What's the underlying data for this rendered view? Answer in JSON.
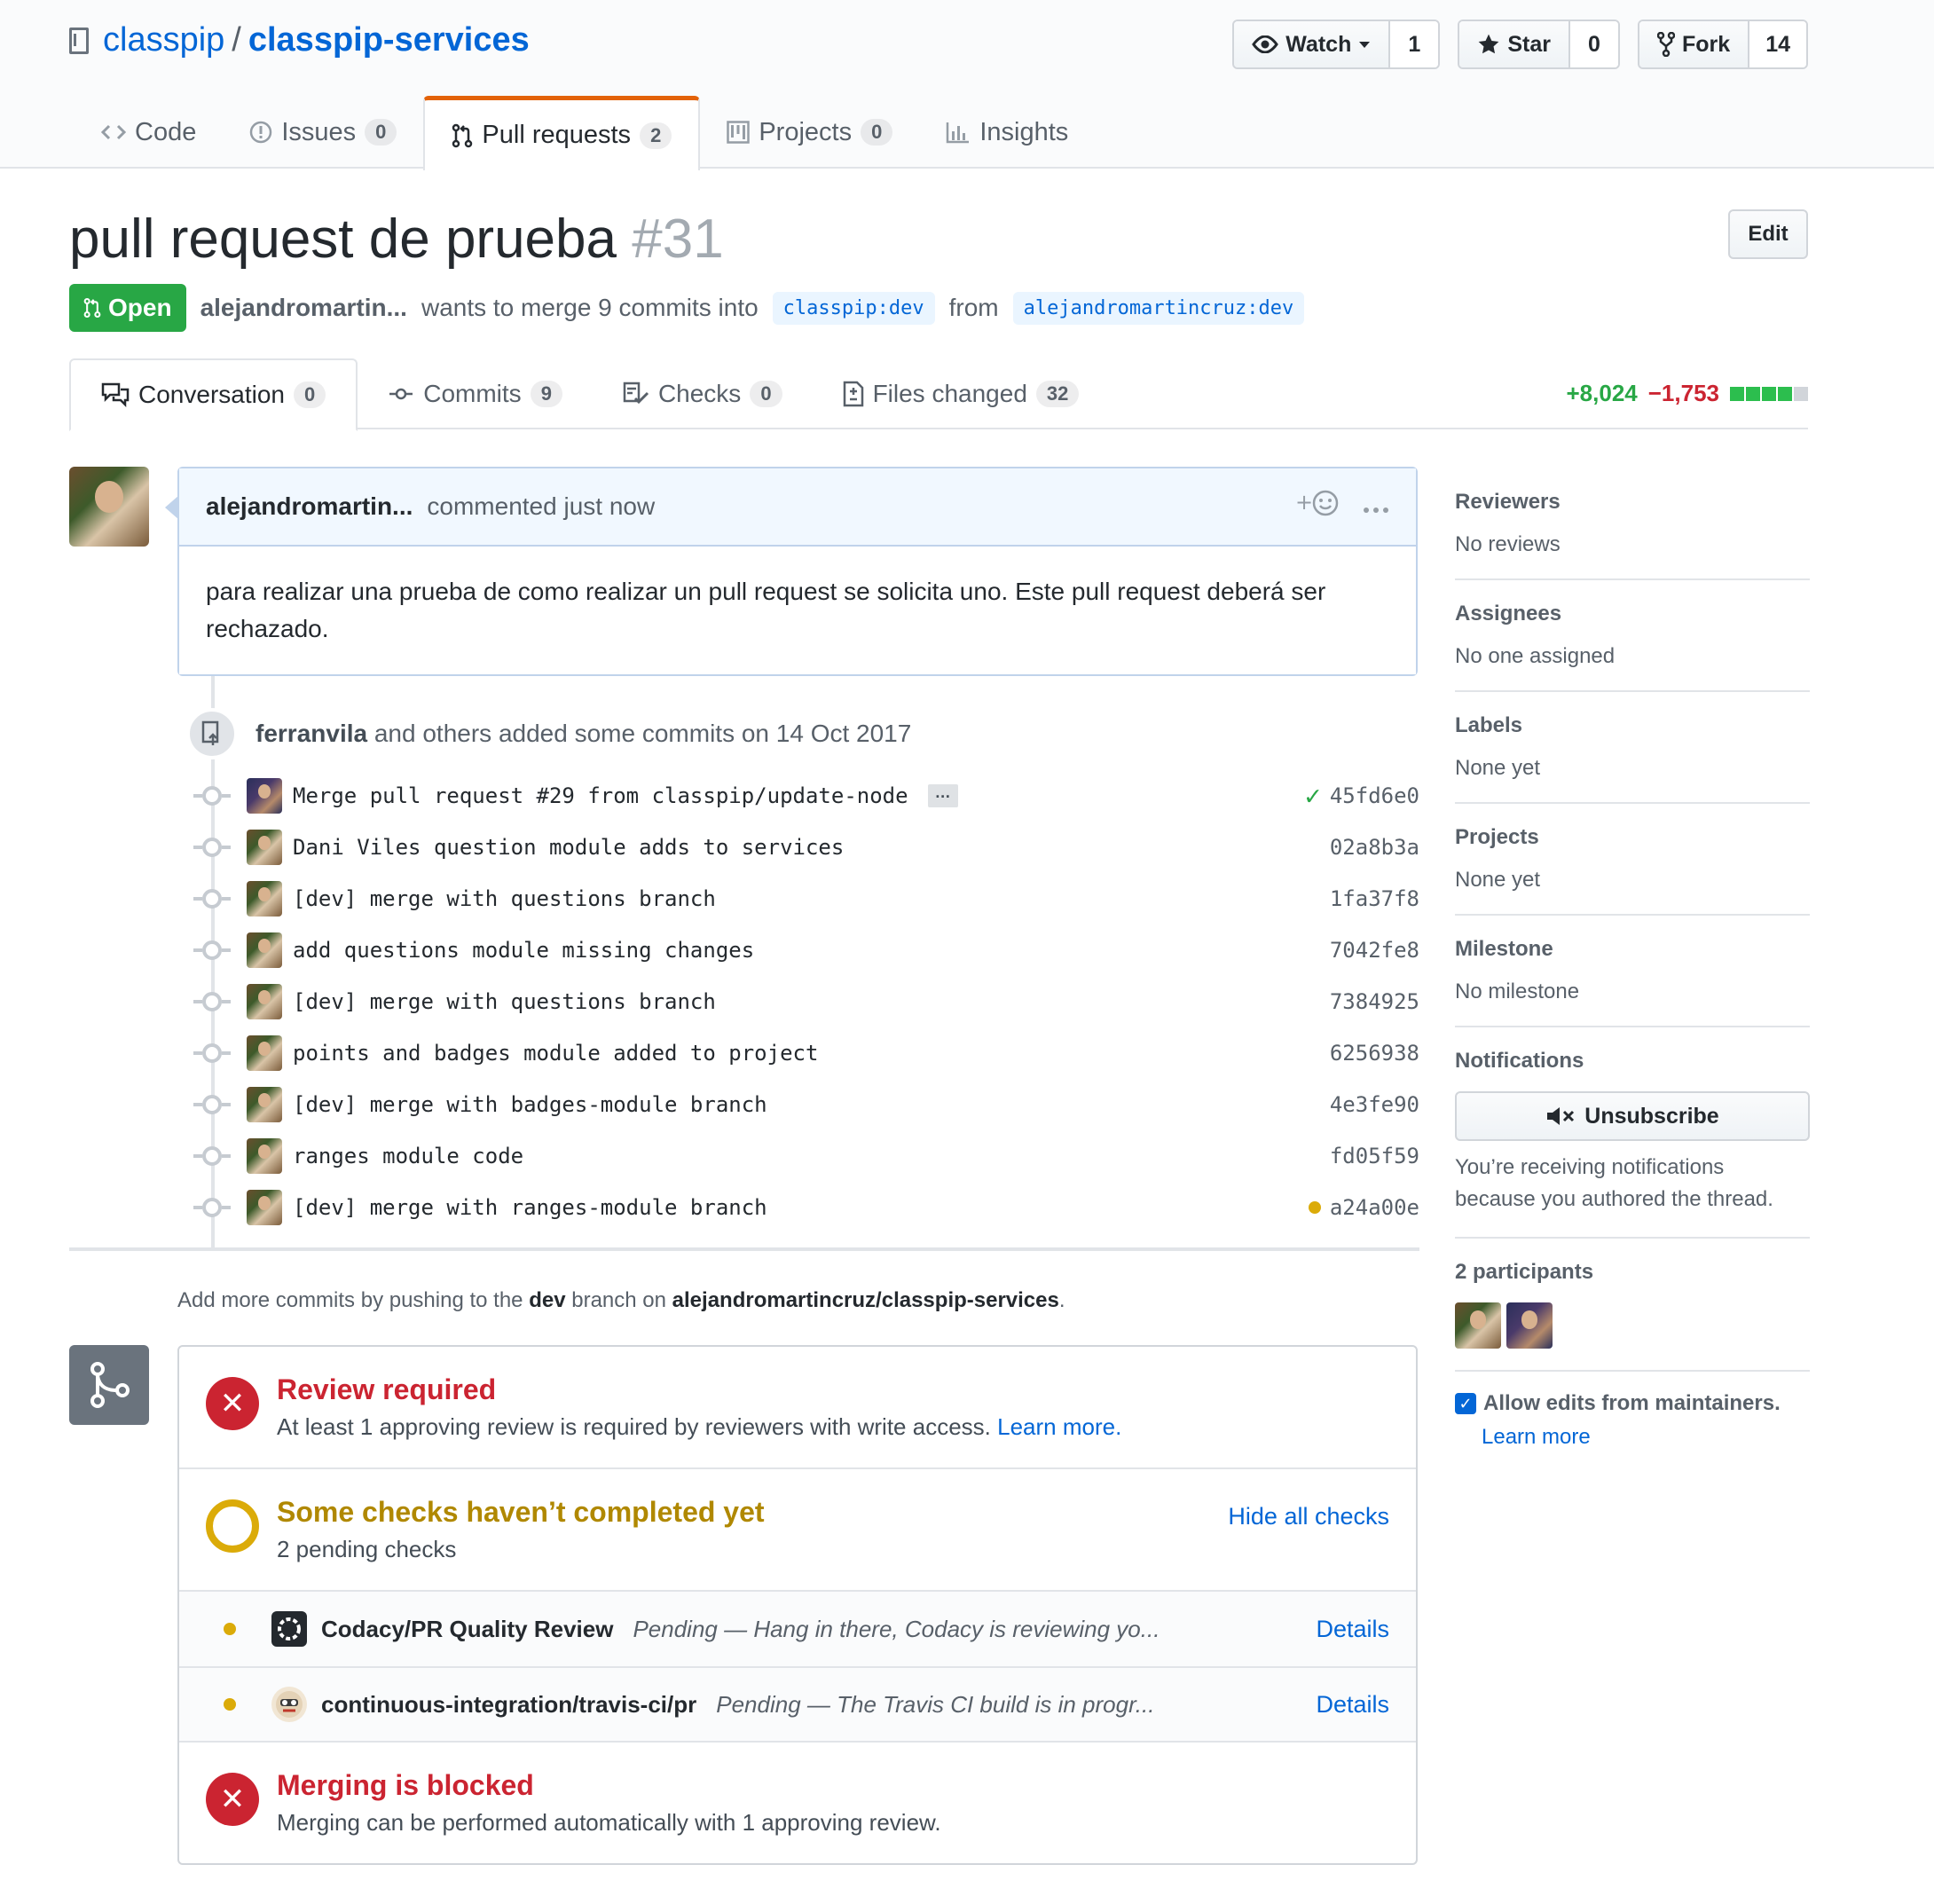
{
  "repo": {
    "owner": "classpip",
    "separator": "/",
    "name": "classpip-services"
  },
  "actions": {
    "watch": {
      "label": "Watch",
      "count": "1"
    },
    "star": {
      "label": "Star",
      "count": "0"
    },
    "fork": {
      "label": "Fork",
      "count": "14"
    }
  },
  "reponav": [
    {
      "label": "Code",
      "count": null
    },
    {
      "label": "Issues",
      "count": "0"
    },
    {
      "label": "Pull requests",
      "count": "2"
    },
    {
      "label": "Projects",
      "count": "0"
    },
    {
      "label": "Insights",
      "count": null
    }
  ],
  "pr": {
    "title": "pull request de prueba",
    "number": "#31",
    "edit_label": "Edit",
    "state": "Open",
    "author": "alejandromartin...",
    "merge_text": "wants to merge 9 commits into",
    "base_branch": "classpip:dev",
    "from_text": "from",
    "head_branch": "alejandromartincruz:dev"
  },
  "tabs": [
    {
      "label": "Conversation",
      "count": "0"
    },
    {
      "label": "Commits",
      "count": "9"
    },
    {
      "label": "Checks",
      "count": "0"
    },
    {
      "label": "Files changed",
      "count": "32"
    }
  ],
  "diffstat": {
    "additions": "+8,024",
    "deletions": "−1,753"
  },
  "comment": {
    "author": "alejandromartin...",
    "meta": "commented just now",
    "body": "para realizar una prueba de como realizar un pull request se solicita uno. Este pull request deberá ser rechazado."
  },
  "commit_group": {
    "who": "ferranvila",
    "text": "and others added some commits on 14 Oct 2017"
  },
  "commits": [
    {
      "message": "Merge pull request #29 from classpip/update-node",
      "sha": "45fd6e0",
      "status": "success",
      "ellipsis": "…"
    },
    {
      "message": "Dani Viles question module adds to services",
      "sha": "02a8b3a"
    },
    {
      "message": "[dev] merge with questions branch",
      "sha": "1fa37f8"
    },
    {
      "message": "add questions module missing changes",
      "sha": "7042fe8"
    },
    {
      "message": "[dev] merge with questions branch",
      "sha": "7384925"
    },
    {
      "message": "points and badges module added to project",
      "sha": "6256938"
    },
    {
      "message": "[dev] merge with badges-module branch",
      "sha": "4e3fe90"
    },
    {
      "message": "ranges module code",
      "sha": "fd05f59"
    },
    {
      "message": "[dev] merge with ranges-module branch",
      "sha": "a24a00e",
      "status": "pending"
    }
  ],
  "push_hint": {
    "prefix": "Add more commits by pushing to the",
    "branch": "dev",
    "middle": "branch on",
    "repo": "alejandromartincruz/classpip-services",
    "suffix": "."
  },
  "merge": {
    "review": {
      "title": "Review required",
      "desc": "At least 1 approving review is required by reviewers with write access.",
      "link": "Learn more."
    },
    "checks": {
      "title": "Some checks haven’t completed yet",
      "desc": "2 pending checks",
      "toggle": "Hide all checks"
    },
    "check_items": [
      {
        "name": "Codacy/PR Quality Review",
        "desc": "Pending — Hang in there, Codacy is reviewing yo...",
        "link": "Details"
      },
      {
        "name": "continuous-integration/travis-ci/pr",
        "desc": "Pending — The Travis CI build is in progr...",
        "link": "Details"
      }
    ],
    "blocked": {
      "title": "Merging is blocked",
      "desc": "Merging can be performed automatically with 1 approving review."
    }
  },
  "sidebar": {
    "reviewers": {
      "head": "Reviewers",
      "value": "No reviews"
    },
    "assignees": {
      "head": "Assignees",
      "value": "No one assigned"
    },
    "labels": {
      "head": "Labels",
      "value": "None yet"
    },
    "projects": {
      "head": "Projects",
      "value": "None yet"
    },
    "milestone": {
      "head": "Milestone",
      "value": "No milestone"
    },
    "notifications": {
      "head": "Notifications",
      "button": "Unsubscribe",
      "note": "You’re receiving notifications because you authored the thread."
    },
    "participants": {
      "head": "2 participants"
    },
    "allow_edits": {
      "label": "Allow edits from maintainers.",
      "link": "Learn more"
    }
  },
  "colors": {
    "open": "#28a745",
    "blocked": "#cb2431",
    "pending": "#dbab09",
    "link": "#0366d6",
    "tab_accent": "#e36209"
  }
}
